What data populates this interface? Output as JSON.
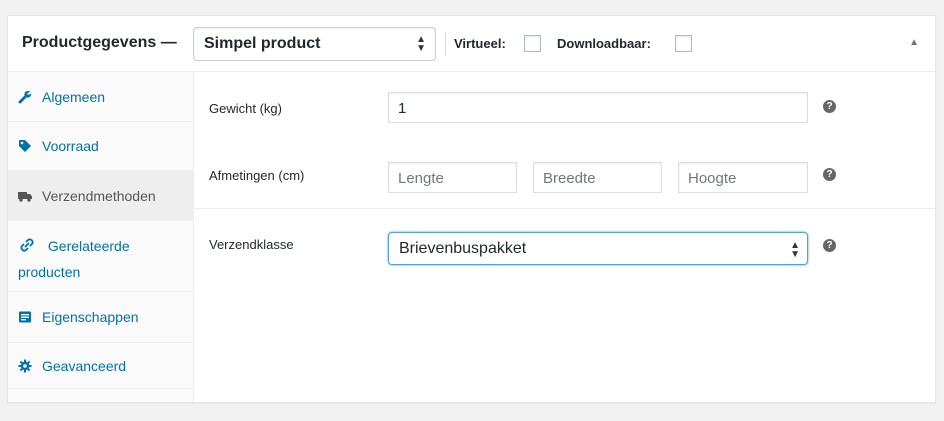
{
  "header": {
    "title": "Productgegevens —",
    "product_type": "Simpel product",
    "virtual_label": "Virtueel:",
    "virtual_checked": false,
    "downloadable_label": "Downloadbaar:",
    "downloadable_checked": false,
    "collapse_icon": "triangle-up-icon"
  },
  "tabs": [
    {
      "label": "Algemeen",
      "icon": "wrench-icon",
      "active": false
    },
    {
      "label": "Voorraad",
      "icon": "tag-icon",
      "active": false
    },
    {
      "label": "Verzendmethoden",
      "icon": "truck-icon",
      "active": true
    },
    {
      "label": "Gerelateerde producten",
      "icon": "link-icon",
      "active": false
    },
    {
      "label": "Eigenschappen",
      "icon": "list-icon",
      "active": false
    },
    {
      "label": "Geavanceerd",
      "icon": "gear-icon",
      "active": false
    }
  ],
  "shipping": {
    "weight_label": "Gewicht (kg)",
    "weight_value": "1",
    "dimensions_label": "Afmetingen (cm)",
    "length_placeholder": "Lengte",
    "width_placeholder": "Breedte",
    "height_placeholder": "Hoogte",
    "class_label": "Verzendklasse",
    "class_value": "Brievenbuspakket",
    "help_glyph": "?"
  },
  "colors": {
    "link": "#0073aa",
    "active_tab_bg": "#eeeeee",
    "focus_border": "#5b9dd9"
  }
}
